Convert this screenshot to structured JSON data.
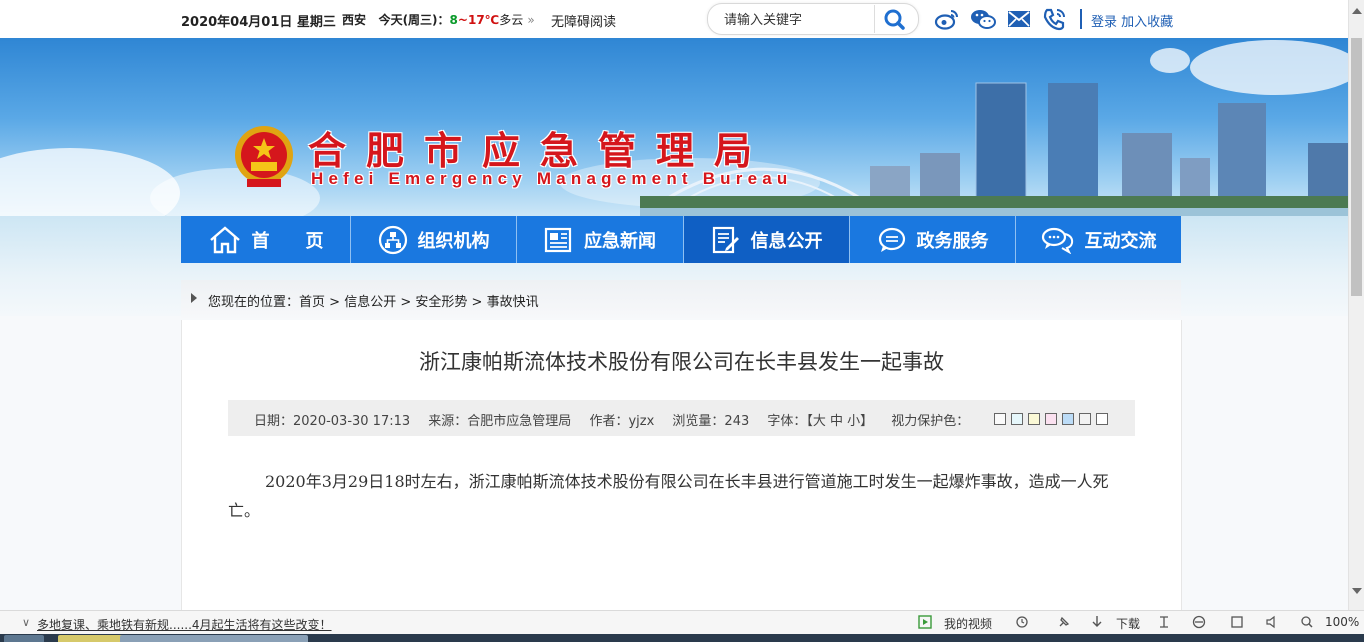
{
  "topbar": {
    "date": "2020年04月01日 星期三",
    "city": "西安",
    "today_label": "今天(周三)：",
    "temp_low": "8",
    "temp_sep": "~",
    "temp_high": "17℃",
    "weather": "多云",
    "more_glyph": "»",
    "accessibility": "无障碍阅读",
    "search_placeholder": "请输入关键字",
    "login": "登录",
    "favorite": "加入收藏"
  },
  "header": {
    "title": "合肥市应急管理局",
    "subtitle": "Hefei Emergency Management Bureau"
  },
  "nav": [
    {
      "label": "首　　页",
      "icon": "home-icon"
    },
    {
      "label": "组织机构",
      "icon": "org-chart-icon"
    },
    {
      "label": "应急新闻",
      "icon": "newspaper-icon"
    },
    {
      "label": "信息公开",
      "icon": "document-edit-icon"
    },
    {
      "label": "政务服务",
      "icon": "chat-bubble-icon"
    },
    {
      "label": "互动交流",
      "icon": "chat-bubbles-icon"
    }
  ],
  "breadcrumb": {
    "prefix": "您现在的位置：",
    "items": [
      "首页",
      "信息公开",
      "安全形势",
      "事故快讯"
    ],
    "separator": " > "
  },
  "article": {
    "title": "浙江康帕斯流体技术股份有限公司在长丰县发生一起事故",
    "date": "日期：2020-03-30 17:13",
    "source": "来源：合肥市应急管理局",
    "author": "作者：yjzx",
    "views": "浏览量：243",
    "font_label": "字体：【大 中 小】",
    "eye_label": "视力保护色：",
    "eye_colors": [
      "#fafafa",
      "#e6f7fb",
      "#fbf9d6",
      "#fbe1f0",
      "#bcdcf7",
      "#f2f2f2",
      "#ffffff"
    ],
    "body": "2020年3月29日18时左右，浙江康帕斯流体技术股份有限公司在长丰县进行管道施工时发生一起爆炸事故，造成一人死亡。"
  },
  "statusbar": {
    "news": "多地复课、乘地铁有新规......4月起生活将有这些改变！",
    "my_video": "我的视频",
    "download": "下载",
    "zoom": "100%"
  },
  "colors": {
    "nav_blue": "#1a78e0",
    "nav_active": "#0f5fc4",
    "title_red": "#d5161c",
    "link_blue": "#1f5fb4"
  }
}
